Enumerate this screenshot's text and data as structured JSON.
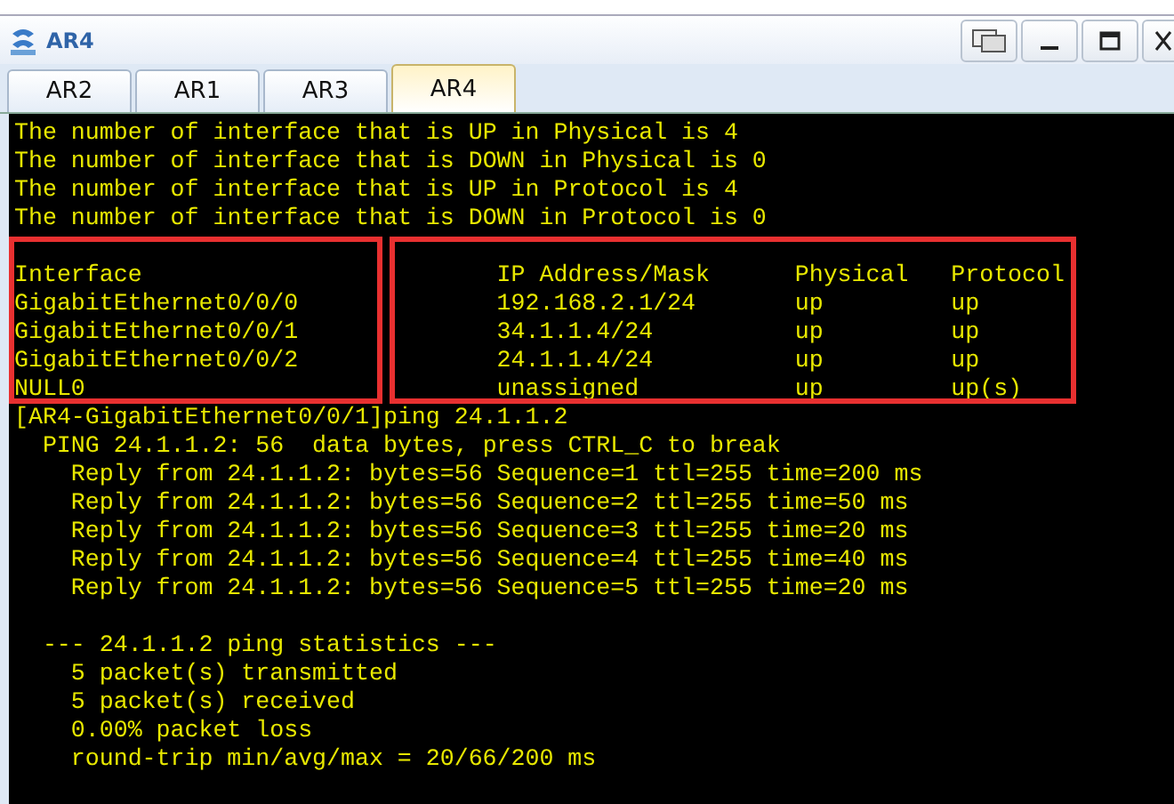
{
  "window": {
    "title": "AR4"
  },
  "tabs": [
    {
      "label": "AR2",
      "selected": false
    },
    {
      "label": "AR1",
      "selected": false
    },
    {
      "label": "AR3",
      "selected": false
    },
    {
      "label": "AR4",
      "selected": true
    }
  ],
  "terminal": {
    "summary_lines": [
      "The number of interface that is UP in Physical is 4",
      "The number of interface that is DOWN in Physical is 0",
      "The number of interface that is UP in Protocol is 4",
      "The number of interface that is DOWN in Protocol is 0"
    ],
    "interface_table": {
      "columns": [
        "Interface",
        "IP Address/Mask",
        "Physical",
        "Protocol"
      ],
      "rows": [
        [
          "GigabitEthernet0/0/0",
          "192.168.2.1/24",
          "up",
          "up"
        ],
        [
          "GigabitEthernet0/0/1",
          "34.1.1.4/24",
          "up",
          "up"
        ],
        [
          "GigabitEthernet0/0/2",
          "24.1.1.4/24",
          "up",
          "up"
        ],
        [
          "NULL0",
          "unassigned",
          "up",
          "up(s)"
        ]
      ]
    },
    "command": "[AR4-GigabitEthernet0/0/1]ping 24.1.1.2",
    "ping_header": "PING 24.1.1.2: 56  data bytes, press CTRL_C to break",
    "replies": [
      "Reply from 24.1.1.2: bytes=56 Sequence=1 ttl=255 time=200 ms",
      "Reply from 24.1.1.2: bytes=56 Sequence=2 ttl=255 time=50 ms",
      "Reply from 24.1.1.2: bytes=56 Sequence=3 ttl=255 time=20 ms",
      "Reply from 24.1.1.2: bytes=56 Sequence=4 ttl=255 time=40 ms",
      "Reply from 24.1.1.2: bytes=56 Sequence=5 ttl=255 time=20 ms"
    ],
    "statistics_title": "--- 24.1.1.2 ping statistics ---",
    "statistics": [
      "5 packet(s) transmitted",
      "5 packet(s) received",
      "0.00% packet loss",
      "round-trip min/avg/max = 20/66/200 ms"
    ]
  }
}
